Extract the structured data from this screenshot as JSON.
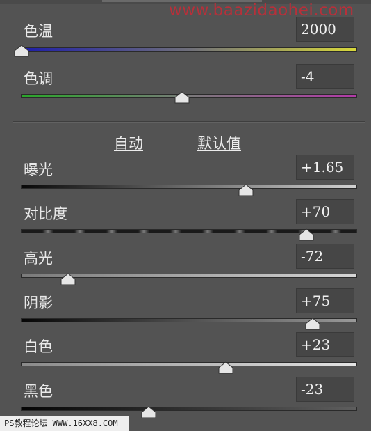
{
  "watermark": "www.baazidaohei.com",
  "white_balance": {
    "temperature": {
      "label": "色温",
      "value": "2000",
      "position": 0.0
    },
    "tint": {
      "label": "色调",
      "value": "-4",
      "position": 0.48
    }
  },
  "actions": {
    "auto": "自动",
    "default": "默认值"
  },
  "tone": {
    "exposure": {
      "label": "曝光",
      "value": "+1.65",
      "position": 0.67
    },
    "contrast": {
      "label": "对比度",
      "value": "+70",
      "position": 0.85
    },
    "highlights": {
      "label": "高光",
      "value": "-72",
      "position": 0.14
    },
    "shadows": {
      "label": "阴影",
      "value": "+75",
      "position": 0.87
    },
    "whites": {
      "label": "白色",
      "value": "+23",
      "position": 0.61
    },
    "blacks": {
      "label": "黑色",
      "value": "-23",
      "position": 0.38
    }
  },
  "footer": "PS教程论坛 WWW.16XX8.COM"
}
